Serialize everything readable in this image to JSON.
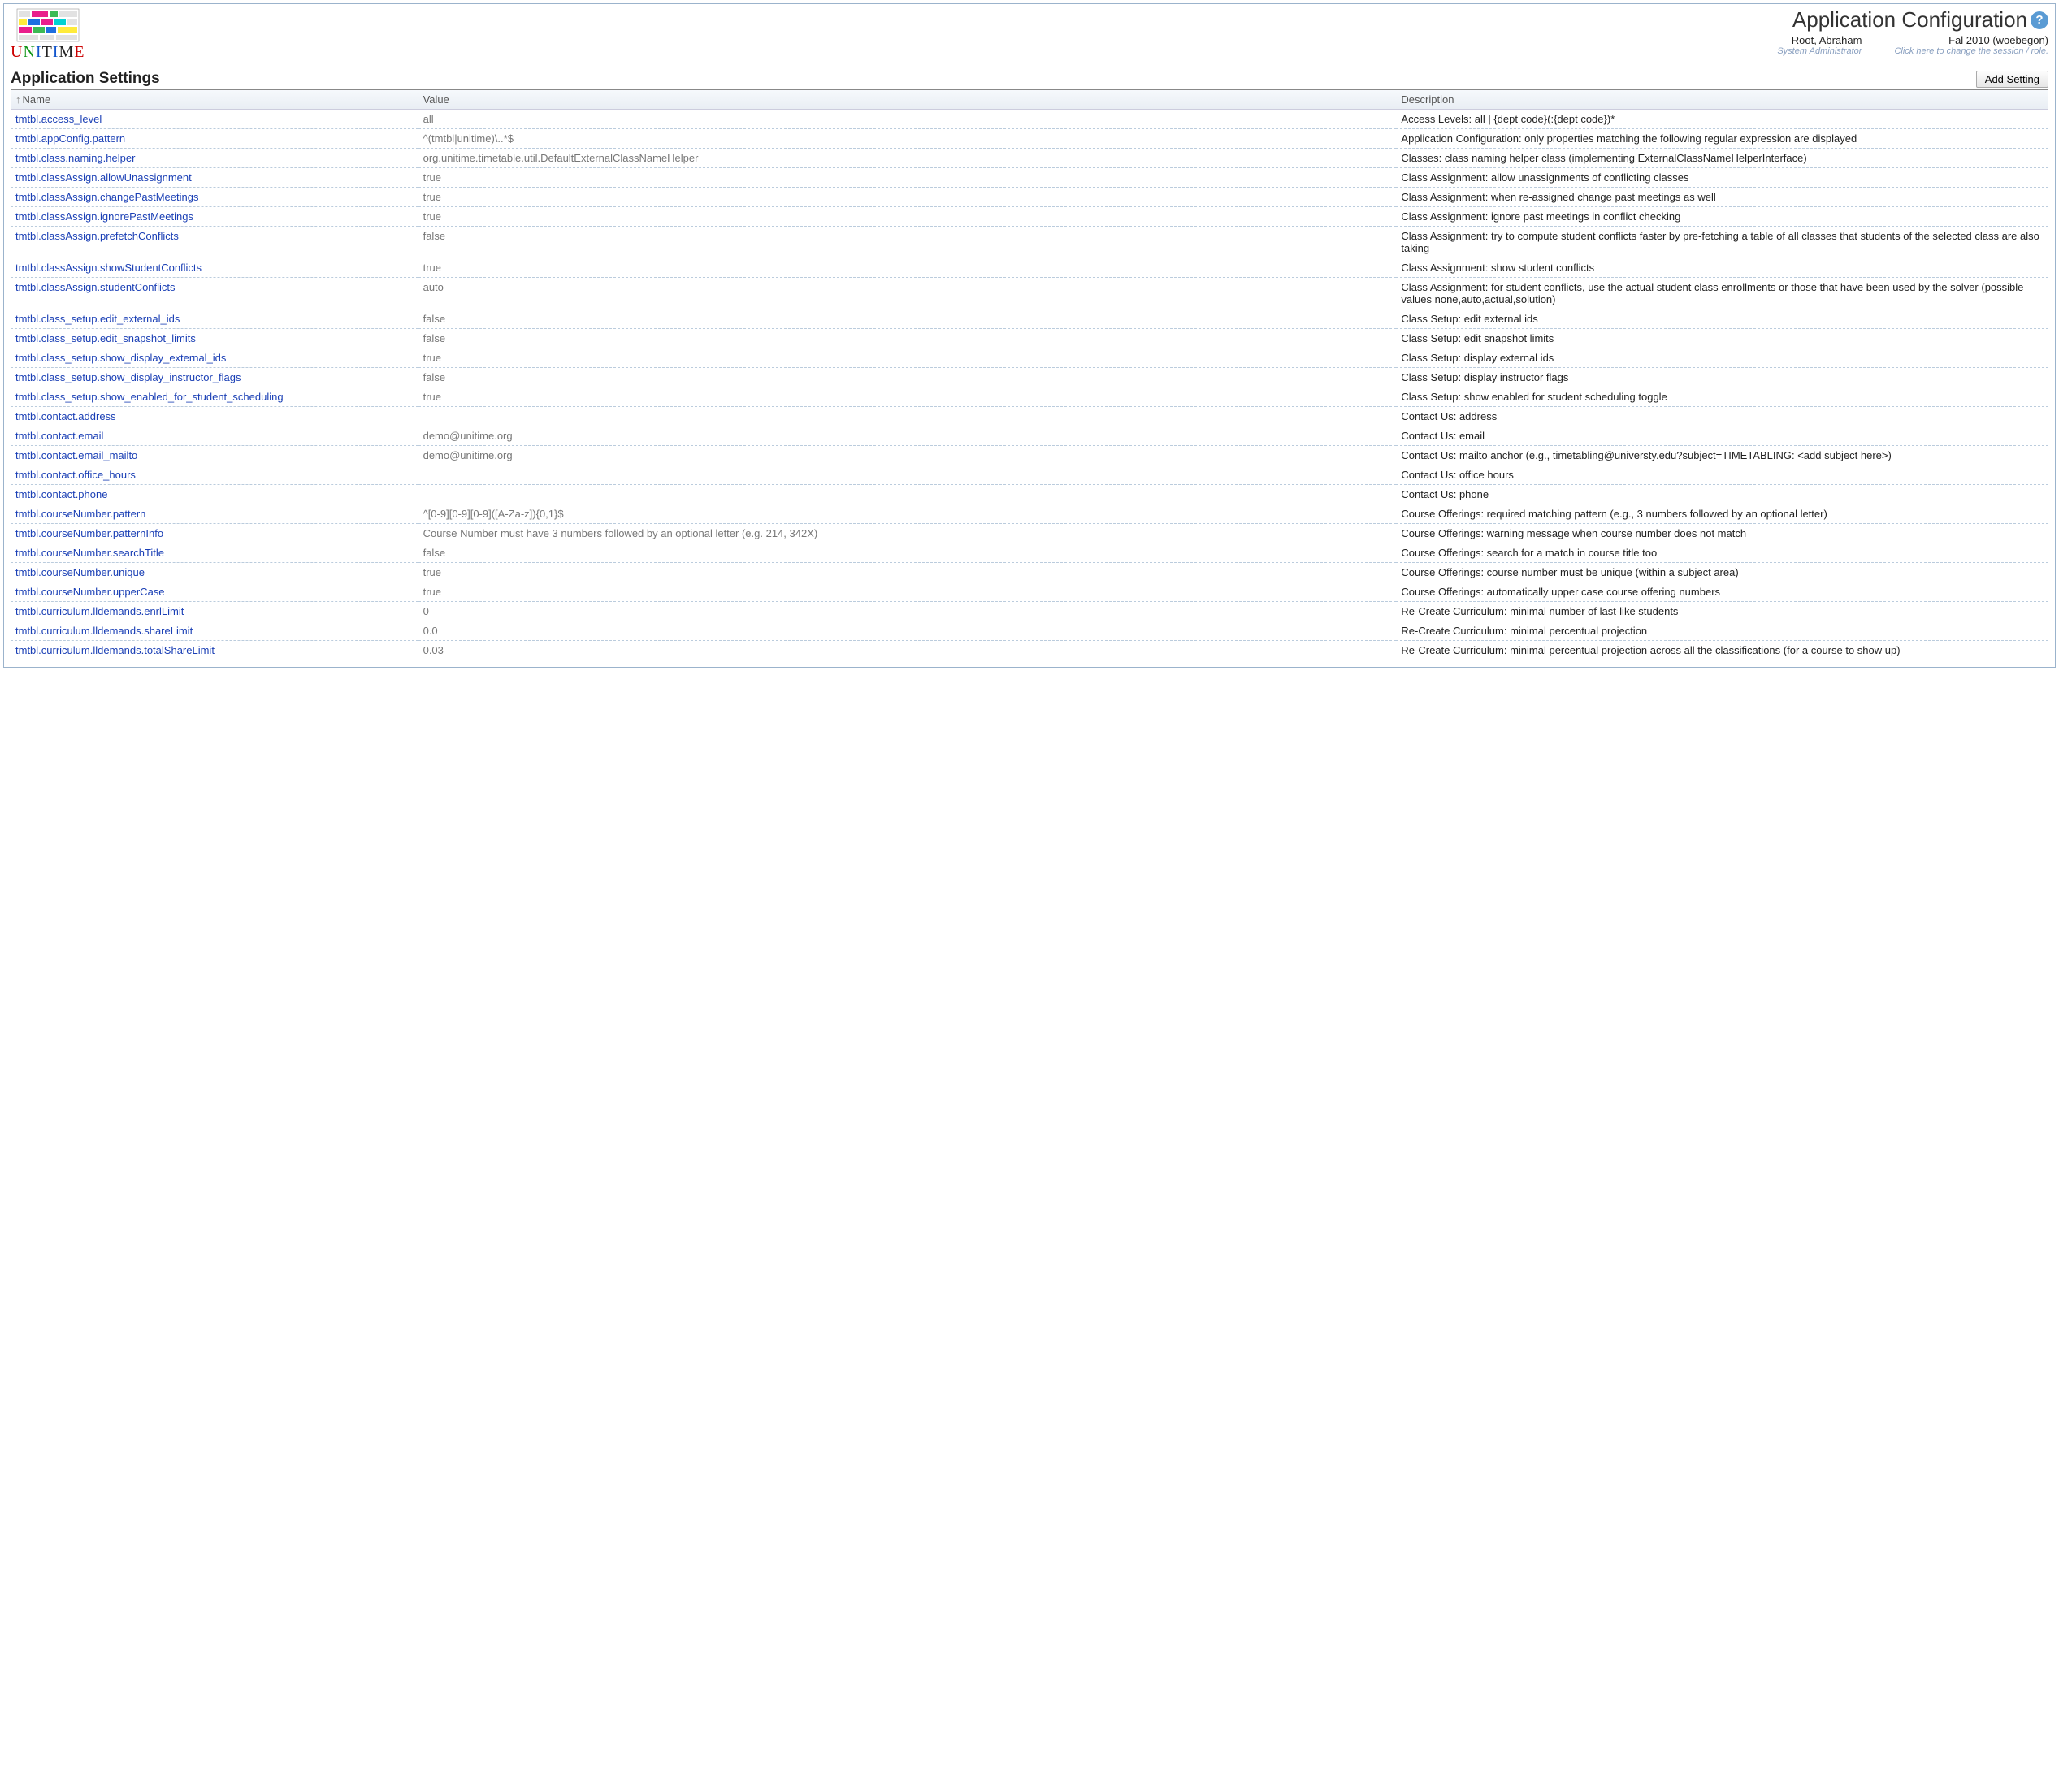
{
  "header": {
    "page_title": "Application Configuration",
    "user_name": "Root, Abraham",
    "user_role": "System Administrator",
    "session_name": "Fal 2010 (woebegon)",
    "session_hint": "Click here to change the session / role."
  },
  "section": {
    "title": "Application Settings",
    "add_button": "Add Setting"
  },
  "columns": {
    "name": "Name",
    "value": "Value",
    "description": "Description",
    "sort_indicator": "↑"
  },
  "rows": [
    {
      "name": "tmtbl.access_level",
      "value": "all",
      "desc": "Access Levels: all | {dept code}(:{dept code})*"
    },
    {
      "name": "tmtbl.appConfig.pattern",
      "value": "^(tmtbl|unitime)\\..*$",
      "desc": "Application Configuration: only properties matching the following regular expression are displayed"
    },
    {
      "name": "tmtbl.class.naming.helper",
      "value": "org.unitime.timetable.util.DefaultExternalClassNameHelper",
      "desc": "Classes: class naming helper class (implementing ExternalClassNameHelperInterface)"
    },
    {
      "name": "tmtbl.classAssign.allowUnassignment",
      "value": "true",
      "desc": "Class Assignment: allow unassignments of conflicting classes"
    },
    {
      "name": "tmtbl.classAssign.changePastMeetings",
      "value": "true",
      "desc": "Class Assignment: when re-assigned change past meetings as well"
    },
    {
      "name": "tmtbl.classAssign.ignorePastMeetings",
      "value": "true",
      "desc": "Class Assignment: ignore past meetings in conflict checking"
    },
    {
      "name": "tmtbl.classAssign.prefetchConflicts",
      "value": "false",
      "desc": "Class Assignment: try to compute student conflicts faster by pre-fetching a table of all classes that students of the selected class are also taking"
    },
    {
      "name": "tmtbl.classAssign.showStudentConflicts",
      "value": "true",
      "desc": "Class Assignment: show student conflicts"
    },
    {
      "name": "tmtbl.classAssign.studentConflicts",
      "value": "auto",
      "desc": "Class Assignment: for student conflicts, use the actual student class enrollments or those that have been used by the solver (possible values none,auto,actual,solution)"
    },
    {
      "name": "tmtbl.class_setup.edit_external_ids",
      "value": "false",
      "desc": "Class Setup: edit external ids"
    },
    {
      "name": "tmtbl.class_setup.edit_snapshot_limits",
      "value": "false",
      "desc": "Class Setup: edit snapshot limits"
    },
    {
      "name": "tmtbl.class_setup.show_display_external_ids",
      "value": "true",
      "desc": "Class Setup: display external ids"
    },
    {
      "name": "tmtbl.class_setup.show_display_instructor_flags",
      "value": "false",
      "desc": "Class Setup: display instructor flags"
    },
    {
      "name": "tmtbl.class_setup.show_enabled_for_student_scheduling",
      "value": "true",
      "desc": "Class Setup: show enabled for student scheduling toggle"
    },
    {
      "name": "tmtbl.contact.address",
      "value": "",
      "desc": "Contact Us: address"
    },
    {
      "name": "tmtbl.contact.email",
      "value": "demo@unitime.org",
      "desc": "Contact Us: email"
    },
    {
      "name": "tmtbl.contact.email_mailto",
      "value": "demo@unitime.org",
      "desc": "Contact Us: mailto anchor (e.g., timetabling@universty.edu?subject=TIMETABLING: <add subject here>)"
    },
    {
      "name": "tmtbl.contact.office_hours",
      "value": "",
      "desc": "Contact Us: office hours"
    },
    {
      "name": "tmtbl.contact.phone",
      "value": "",
      "desc": "Contact Us: phone"
    },
    {
      "name": "tmtbl.courseNumber.pattern",
      "value": "^[0-9][0-9][0-9]([A-Za-z]){0,1}$",
      "desc": "Course Offerings: required matching pattern (e.g., 3 numbers followed by an optional letter)"
    },
    {
      "name": "tmtbl.courseNumber.patternInfo",
      "value": "Course Number must have 3 numbers followed by an optional letter (e.g. 214, 342X)",
      "desc": "Course Offerings: warning message when course number does not match"
    },
    {
      "name": "tmtbl.courseNumber.searchTitle",
      "value": "false",
      "desc": "Course Offerings: search for a match in course title too"
    },
    {
      "name": "tmtbl.courseNumber.unique",
      "value": "true",
      "desc": "Course Offerings: course number must be unique (within a subject area)"
    },
    {
      "name": "tmtbl.courseNumber.upperCase",
      "value": "true",
      "desc": "Course Offerings: automatically upper case course offering numbers"
    },
    {
      "name": "tmtbl.curriculum.lldemands.enrlLimit",
      "value": "0",
      "desc": "Re-Create Curriculum: minimal number of last-like students"
    },
    {
      "name": "tmtbl.curriculum.lldemands.shareLimit",
      "value": "0.0",
      "desc": "Re-Create Curriculum: minimal percentual projection"
    },
    {
      "name": "tmtbl.curriculum.lldemands.totalShareLimit",
      "value": "0.03",
      "desc": "Re-Create Curriculum: minimal percentual projection across all the classifications (for a course to show up)"
    }
  ]
}
